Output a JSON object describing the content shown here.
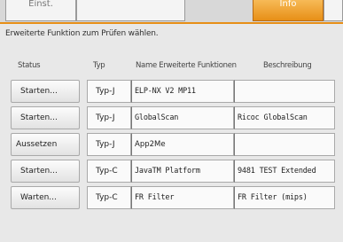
{
  "tabs": [
    {
      "label": "Einst."
    },
    {
      "label": ""
    },
    {
      "label": "Info"
    },
    {
      "label": ""
    }
  ],
  "instruction": "Erweiterte Funktion zum Prüfen wählen.",
  "headers": {
    "status": "Status",
    "type": "Typ",
    "name": "Name Erweiterte Funktionen",
    "description": "Beschreibung"
  },
  "rows": [
    {
      "status": "Starten...",
      "type": "Typ-J",
      "name": "ELP-NX V2 MP11",
      "description": ""
    },
    {
      "status": "Starten...",
      "type": "Typ-J",
      "name": "GlobalScan",
      "description": "Ricoc GlobalScan"
    },
    {
      "status": "Aussetzen",
      "type": "Typ-J",
      "name": "App2Me",
      "description": ""
    },
    {
      "status": "Starten...",
      "type": "Typ-C",
      "name": "JavaTM Platform",
      "description": "9481 TEST Extended"
    },
    {
      "status": "Warten...",
      "type": "Typ-C",
      "name": "FR Filter",
      "description": "FR Filter (mips)"
    }
  ],
  "colors": {
    "accent": "#e78f17",
    "background": "#e8e8e8"
  }
}
